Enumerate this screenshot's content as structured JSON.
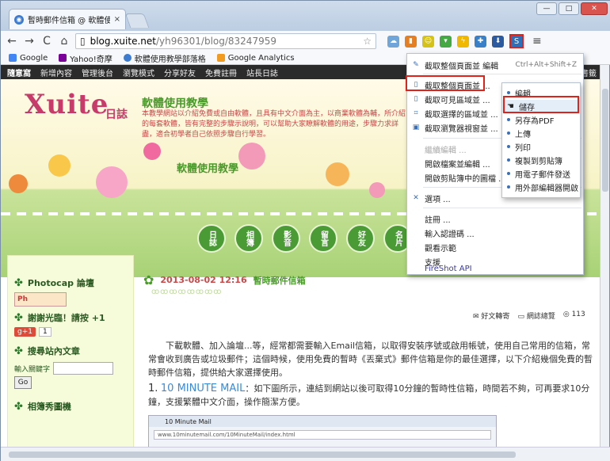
{
  "browser": {
    "tab_title": "暫時郵件信箱 @ 軟體使用",
    "tab_close": "×",
    "url_host": "blog.xuite.net",
    "url_path": "/yh96301/blog/83247959",
    "win_min": "—",
    "win_max": "□",
    "win_close": "✕",
    "back": "←",
    "forward": "→",
    "reload": "C",
    "home": "⌂",
    "star": "☆",
    "fireshot_label": "S",
    "menu": "≡"
  },
  "bookmarks": [
    "Google",
    "Yahoo!奇摩",
    "軟體使用教學部落格",
    "Google Analytics"
  ],
  "sitebar": {
    "logo": "隨意窩",
    "links": [
      "新增內容",
      "管理後台",
      "瀏覽模式",
      "分享好友",
      "免費註冊",
      "站長日誌"
    ],
    "right": "書籤"
  },
  "banner": {
    "logo": "Xuite",
    "logo_sub": "日誌",
    "title": "軟體使用教學",
    "desc": "本教學網站以介紹免費或自由軟體，且具有中文介面為主，以商業軟體為輔，所介紹的每套軟體，皆有完整的步驟示說明，可以幫助大家瞭解軟體的用途，步驟力求詳盡，適合初學者自己依照步驟自行學習。",
    "title2": "軟體使用教學",
    "nav": [
      "日誌",
      "相簿",
      "影音",
      "留言",
      "好友",
      "名片"
    ]
  },
  "sidebar": {
    "heading1": "Photocap 論壇",
    "badge": "Ph",
    "heading2": "謝謝光臨！請按 +1",
    "gplus": "g+1",
    "gcount": "1",
    "heading3": "搜尋站內文章",
    "search_label": "輸入關鍵字",
    "go": "Go",
    "heading4": "相簿秀圖機"
  },
  "post": {
    "date": "2013-08-02 12:16",
    "title": "暫時郵件信箱",
    "tool1": "好文轉寄",
    "tool2": "網誌總覽",
    "tool3": "113",
    "body": "下載軟體、加入論壇...等，經常都需要輸入Email信箱，以取得安裝序號或啟用帳號，使用自己常用的信箱，常常會收到廣告或垃圾郵件；這個時候，使用免費的暫時《丟棄式》郵件信箱是你的最佳選擇，以下介紹幾個免費的暫時郵件信箱，提供給大家選擇使用。",
    "sub_num": "1.",
    "sub_link": "10 MINUTE MAIL",
    "sub_text": "：如下圖所示，連結到網站以後可取得10分鐘的暫時性信箱，時間若不夠，可再要求10分鐘，支援繁體中文介面，操作簡潔方便。",
    "shot_tab": "10 Minute Mail",
    "shot_url": "www.10minutemail.com/10MinuteMail/index.html"
  },
  "menu": {
    "items": [
      {
        "label": "截取整個頁面並 編輯",
        "shortcut": "Ctrl+Alt+Shift+Z"
      },
      {
        "label": "截取整個頁面並 ...",
        "shortcut": ""
      },
      {
        "label": "截取可見區域並 ...",
        "shortcut": ""
      },
      {
        "label": "截取選擇的區域並 ...",
        "shortcut": ""
      },
      {
        "label": "截取瀏覽器視窗並 ...",
        "shortcut": ""
      },
      {
        "label": "繼續編輯 ...",
        "shortcut": ""
      },
      {
        "label": "開啟檔案並編輯 ...",
        "shortcut": ""
      },
      {
        "label": "開啟剪貼簿中的圖檔 ...",
        "shortcut": ""
      },
      {
        "label": "選項 ...",
        "shortcut": ""
      },
      {
        "label": "註冊 ...",
        "shortcut": ""
      },
      {
        "label": "輸入認證碼 ...",
        "shortcut": ""
      },
      {
        "label": "觀看示範",
        "shortcut": ""
      },
      {
        "label": "支援",
        "shortcut": ""
      },
      {
        "label": "FireShot API",
        "shortcut": ""
      }
    ]
  },
  "submenu": {
    "items": [
      "編輯",
      "儲存",
      "另存為PDF",
      "上傳",
      "列印",
      "複製到剪貼簿",
      "用電子郵件發送",
      "用外部編輯器開啟"
    ]
  },
  "colors": {
    "accent_red": "#e0221b",
    "link_blue": "#3b8ad8",
    "blog_green": "#4a9a2a"
  }
}
